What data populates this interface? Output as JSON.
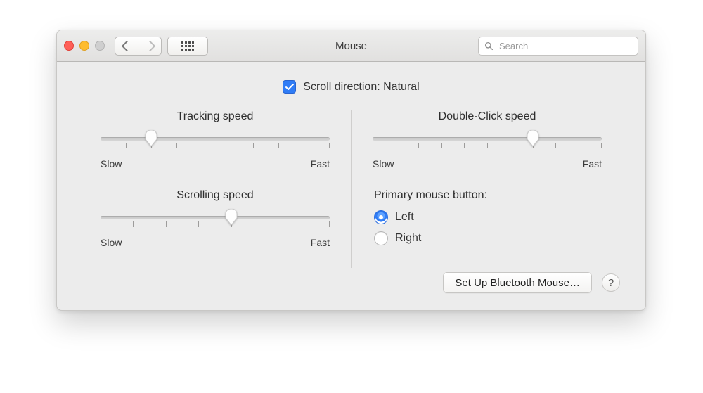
{
  "window": {
    "title": "Mouse"
  },
  "toolbar": {
    "search_placeholder": "Search"
  },
  "scroll_direction": {
    "label": "Scroll direction: Natural",
    "checked": true
  },
  "sliders": {
    "tracking": {
      "title": "Tracking speed",
      "min_label": "Slow",
      "max_label": "Fast",
      "value": 3,
      "max": 10
    },
    "doubleclick": {
      "title": "Double-Click speed",
      "min_label": "Slow",
      "max_label": "Fast",
      "value": 8,
      "max": 11
    },
    "scrolling": {
      "title": "Scrolling speed",
      "min_label": "Slow",
      "max_label": "Fast",
      "value": 5,
      "max": 8
    }
  },
  "primary_button": {
    "title": "Primary mouse button:",
    "options": {
      "left": "Left",
      "right": "Right"
    },
    "selected": "left"
  },
  "footer": {
    "bluetooth_label": "Set Up Bluetooth Mouse…",
    "help_label": "?"
  }
}
